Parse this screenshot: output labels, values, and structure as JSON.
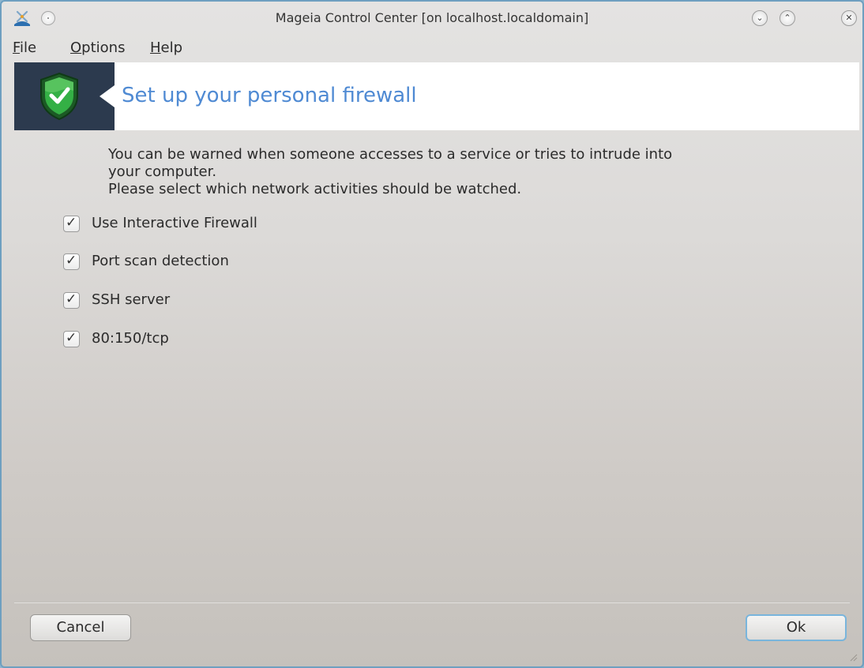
{
  "window": {
    "title": "Mageia Control Center  [on localhost.localdomain]",
    "controls": {
      "minimize": "⌄",
      "maximize": "⌃",
      "close": "✕"
    }
  },
  "menu": {
    "items": [
      {
        "mnemonic": "F",
        "rest": "ile"
      },
      {
        "mnemonic": "O",
        "rest": "ptions"
      },
      {
        "mnemonic": "H",
        "rest": "elp"
      }
    ]
  },
  "banner": {
    "title": "Set up your personal firewall",
    "icon": "shield-check-icon"
  },
  "description": {
    "line1": "You can be warned when someone accesses to a service or tries to intrude into",
    "line2": "your computer.",
    "line3": "Please select which network activities should be watched."
  },
  "options": [
    {
      "label": "Use Interactive Firewall",
      "checked": true
    },
    {
      "label": "Port scan detection",
      "checked": true
    },
    {
      "label": "SSH server",
      "checked": true
    },
    {
      "label": "80:150/tcp",
      "checked": true
    }
  ],
  "buttons": {
    "cancel": "Cancel",
    "ok": "Ok"
  },
  "colors": {
    "banner_dark": "#2c3a4e",
    "title_blue": "#4f8ad3",
    "shield_green": "#2fa53f",
    "focus_border": "#79b5dc"
  }
}
